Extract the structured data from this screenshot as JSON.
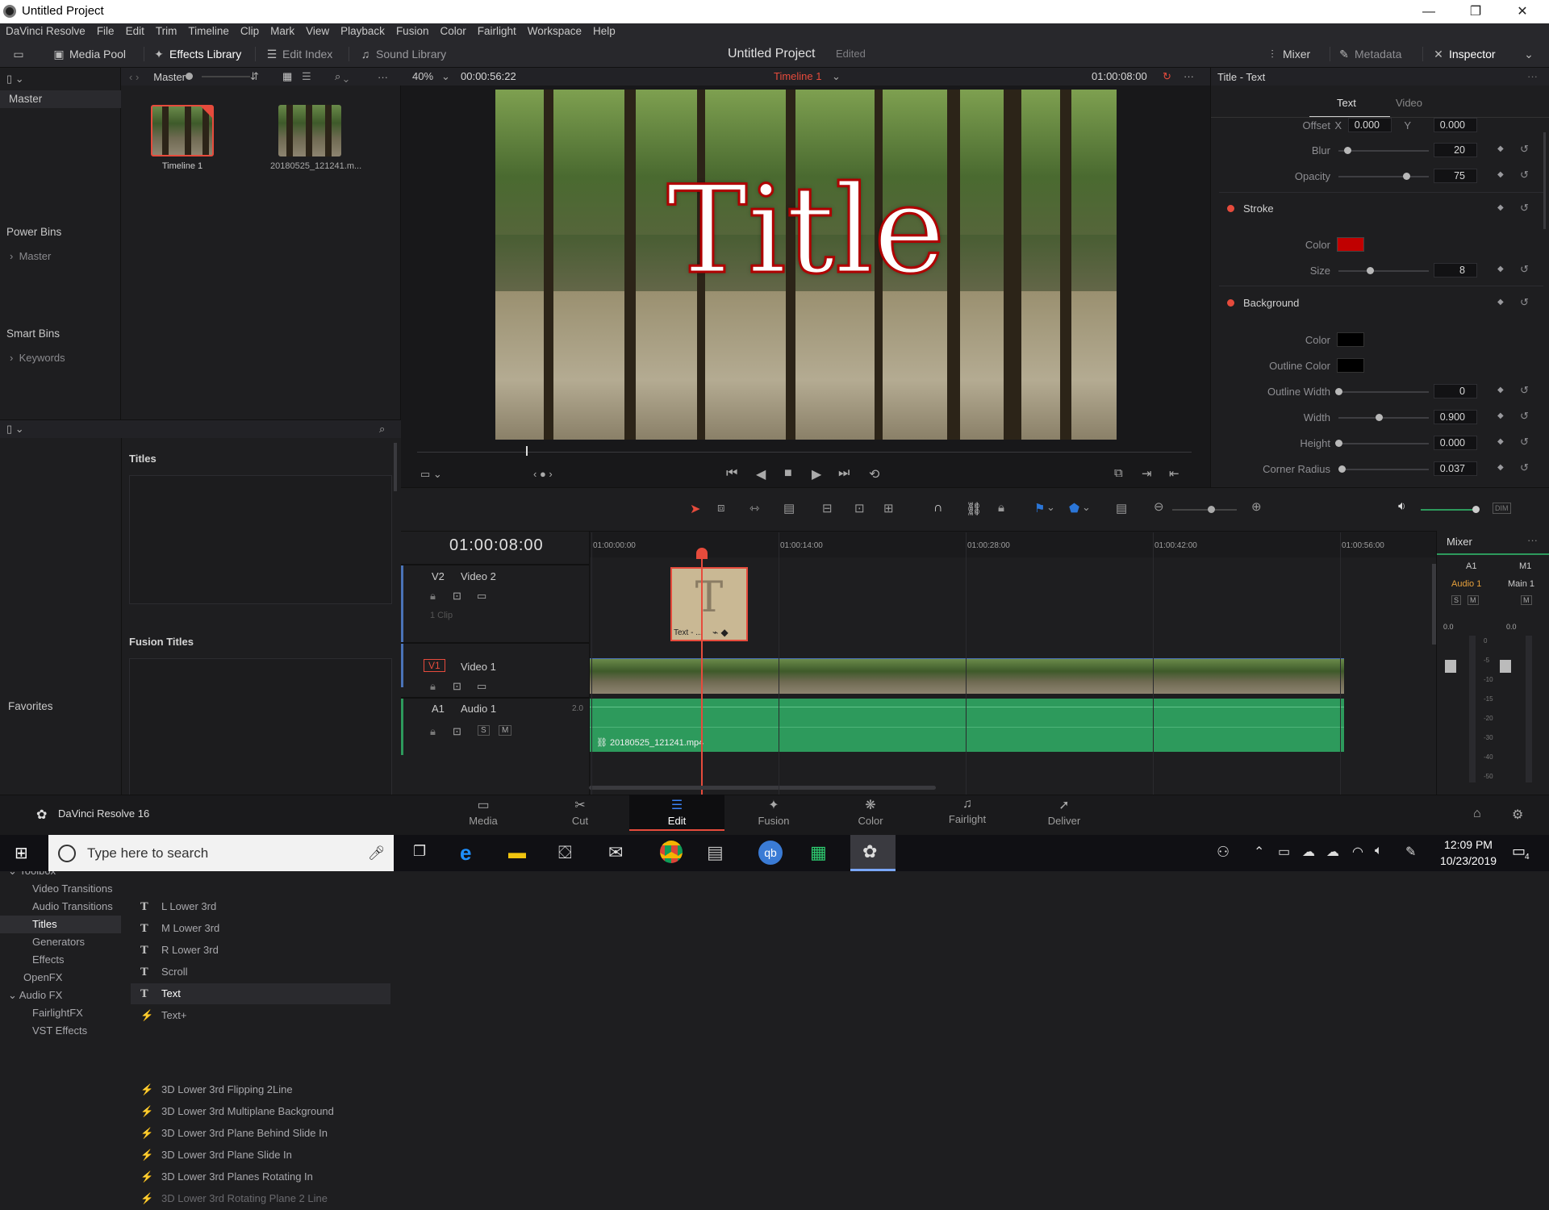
{
  "window": {
    "title": "Untitled Project",
    "minimize": "—",
    "restore": "❐",
    "close": "✕"
  },
  "menu": [
    "DaVinci Resolve",
    "File",
    "Edit",
    "Trim",
    "Timeline",
    "Clip",
    "Mark",
    "View",
    "Playback",
    "Fusion",
    "Color",
    "Fairlight",
    "Workspace",
    "Help"
  ],
  "toolbar": {
    "media_pool": "Media Pool",
    "effects_library": "Effects Library",
    "edit_index": "Edit Index",
    "sound_library": "Sound Library",
    "project_title": "Untitled Project",
    "project_status": "Edited",
    "mixer": "Mixer",
    "metadata": "Metadata",
    "inspector": "Inspector"
  },
  "media_pool": {
    "bin_label": "Master",
    "master_bin": "Master",
    "power_bins": "Power Bins",
    "power_master": "Master",
    "smart_bins": "Smart Bins",
    "keywords": "Keywords",
    "clips": [
      {
        "name": "Timeline 1",
        "selected": true
      },
      {
        "name": "20180525_121241.m...",
        "selected": false
      }
    ]
  },
  "viewer": {
    "zoom": "40%",
    "duration": "00:00:56:22",
    "timeline_name": "Timeline 1",
    "timecode": "01:00:08:00",
    "overlay_title": "Title"
  },
  "effects": {
    "tree": [
      {
        "label": "Toolbox",
        "level": 0,
        "expanded": true
      },
      {
        "label": "Video Transitions",
        "level": 1
      },
      {
        "label": "Audio Transitions",
        "level": 1
      },
      {
        "label": "Titles",
        "level": 1,
        "selected": true
      },
      {
        "label": "Generators",
        "level": 1
      },
      {
        "label": "Effects",
        "level": 1
      },
      {
        "label": "OpenFX",
        "level": 0
      },
      {
        "label": "Audio FX",
        "level": 0,
        "expanded": true
      },
      {
        "label": "FairlightFX",
        "level": 1
      },
      {
        "label": "VST Effects",
        "level": 1
      }
    ],
    "favorites": "Favorites",
    "titles_header": "Titles",
    "titles": [
      "L Lower 3rd",
      "M Lower 3rd",
      "R Lower 3rd",
      "Scroll",
      "Text",
      "Text+"
    ],
    "fusion_header": "Fusion Titles",
    "fusion_titles": [
      "3D Lower 3rd Flipping 2Line",
      "3D Lower 3rd Multiplane Background",
      "3D Lower 3rd Plane Behind Slide In",
      "3D Lower 3rd Plane Slide In",
      "3D Lower 3rd Planes Rotating In",
      "3D Lower 3rd Rotating Plane 2 Line"
    ]
  },
  "inspector": {
    "title": "Title - Text",
    "tab_text": "Text",
    "tab_video": "Video",
    "offset_label": "Offset",
    "offset_x_label": "X",
    "offset_x": "0.000",
    "offset_y_label": "Y",
    "offset_y": "0.000",
    "blur_label": "Blur",
    "blur": "20",
    "opacity_label": "Opacity",
    "opacity": "75",
    "stroke_header": "Stroke",
    "stroke_color_label": "Color",
    "stroke_color": "#c00000",
    "stroke_size_label": "Size",
    "stroke_size": "8",
    "background_header": "Background",
    "bg_color_label": "Color",
    "bg_outline_color_label": "Outline Color",
    "bg_outline_width_label": "Outline Width",
    "bg_outline_width": "0",
    "bg_width_label": "Width",
    "bg_width": "0.900",
    "bg_height_label": "Height",
    "bg_height": "0.000",
    "bg_corner_label": "Corner Radius",
    "bg_corner": "0.037",
    "slider_levels": {
      "blur": 0.1,
      "opacity": 0.75,
      "stroke_size": 0.35,
      "outline_width": 0.0,
      "width": 0.45,
      "height": 0.0,
      "corner": 0.04
    }
  },
  "timeline": {
    "timecode": "01:00:08:00",
    "ruler": [
      "01:00:00:00",
      "01:00:14:00",
      "01:00:28:00",
      "01:00:42:00",
      "01:00:56:00"
    ],
    "tracks": {
      "v2_id": "V2",
      "v2_name": "Video 2",
      "v2_clips": "1 Clip",
      "v1_id": "V1",
      "v1_name": "Video 1",
      "a1_id": "A1",
      "a1_name": "Audio 1",
      "a1_level": "2.0",
      "solo": "S",
      "mute": "M"
    },
    "title_clip_label": "Text - ...",
    "audio_clip_label": "20180525_121241.mp4"
  },
  "mixer": {
    "title": "Mixer",
    "ch1": "A1",
    "ch2": "M1",
    "ch1_name": "Audio 1",
    "ch2_name": "Main 1",
    "solo": "S",
    "mute": "M",
    "gain1": "0.0",
    "gain2": "0.0",
    "scale": [
      "0",
      "-5",
      "-10",
      "-15",
      "-20",
      "-30",
      "-40",
      "-50"
    ]
  },
  "pages": [
    "Media",
    "Cut",
    "Edit",
    "Fusion",
    "Color",
    "Fairlight",
    "Deliver"
  ],
  "active_page": "Edit",
  "brand": "DaVinci Resolve 16",
  "taskbar": {
    "search_placeholder": "Type here to search",
    "time": "12:09 PM",
    "date": "10/23/2019",
    "notifications": "4"
  },
  "colors": {
    "accent_red": "#e64b3c",
    "clip_green": "#2d9a5c",
    "bg": "#1e1e20"
  }
}
